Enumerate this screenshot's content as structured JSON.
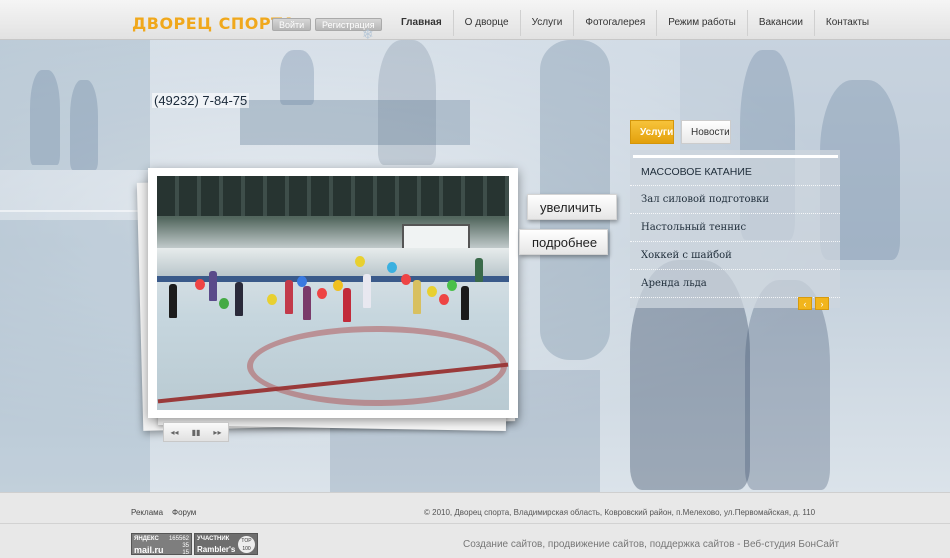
{
  "header": {
    "logo": "ДВОРЕЦ СПОРТА",
    "login_label": "Войти",
    "register_label": "Регистрация",
    "snowflake_icon": "snowflake-icon",
    "nav": [
      {
        "label": "Главная"
      },
      {
        "label": "О дворце"
      },
      {
        "label": "Услуги"
      },
      {
        "label": "Фотогалерея"
      },
      {
        "label": "Режим работы"
      },
      {
        "label": "Вакансии"
      },
      {
        "label": "Контакты"
      }
    ]
  },
  "hero": {
    "phone": "(49232) 7-84-75",
    "zoom_label": "увеличить",
    "more_label": "подробнее",
    "controls": [
      "◂◂",
      "▮▮",
      "▸▸"
    ]
  },
  "panel": {
    "tabs": [
      {
        "label": "Услуги",
        "active": true
      },
      {
        "label": "Новости",
        "active": false
      }
    ],
    "services": [
      "МАССОВОЕ КАТАНИЕ",
      "Зал силовой подготовки",
      "Настольный теннис",
      "Хоккей с шайбой",
      "Аренда льда"
    ],
    "prev_icon": "‹",
    "next_icon": "›"
  },
  "footer": {
    "links": [
      "Реклама",
      "Форум"
    ],
    "copyright": "© 2010, Дворец спорта, Владимирская область, Ковровский район, п.Мелехово, ул.Первомайская, д. 110",
    "counter_mail": {
      "top": "ЯНДЕКС",
      "nums": "165562\n35\n15",
      "brand": "mail.ru"
    },
    "counter_rambler": {
      "top": "УЧАСТНИК",
      "brand": "Rambler's",
      "badge": "TOP\n100"
    },
    "studio": "Создание сайтов, продвижение сайтов, поддержка сайтов - Веб-студия БонСайт"
  },
  "colors": {
    "accent": "#f0a81c",
    "panel_bg": "#cdd6de",
    "footer_bg": "#e8e8e8"
  }
}
